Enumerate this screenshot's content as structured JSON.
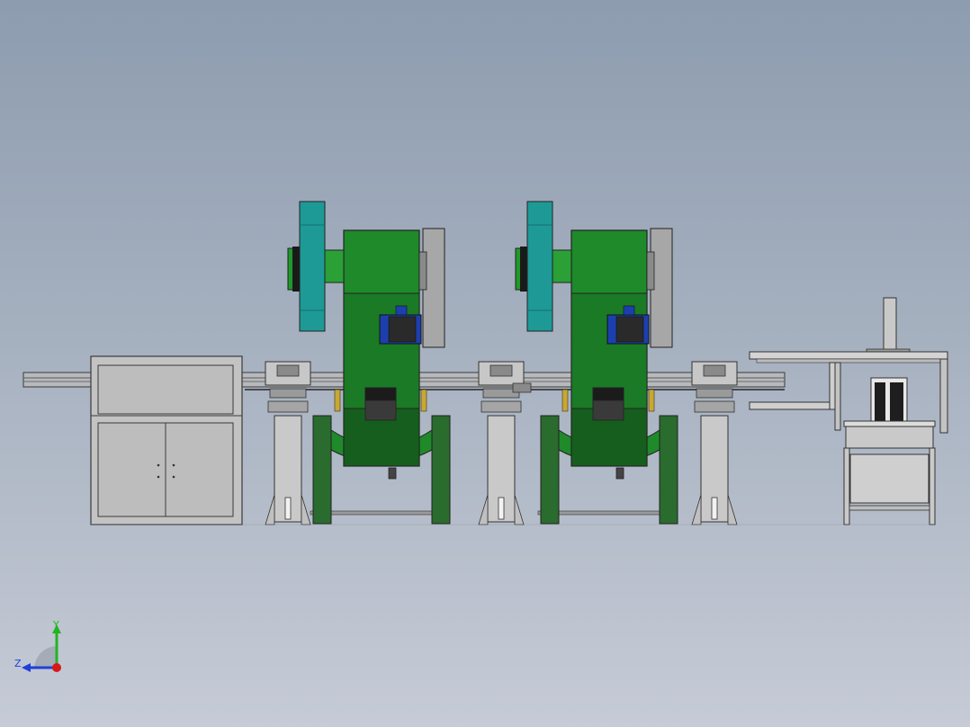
{
  "viewport": {
    "colors": {
      "frame_gray": "#bcbcbc",
      "press_green": "#1f8a2a",
      "press_dark_green": "#165e1d",
      "flywheel_teal": "#1e9a96",
      "motor_blue": "#1d3fae",
      "outline": "#303030"
    }
  },
  "triad": {
    "y_label": "Y",
    "z_label": "Z",
    "y_color": "#22b522",
    "z_color": "#2040d8",
    "origin_color": "#d81818"
  }
}
